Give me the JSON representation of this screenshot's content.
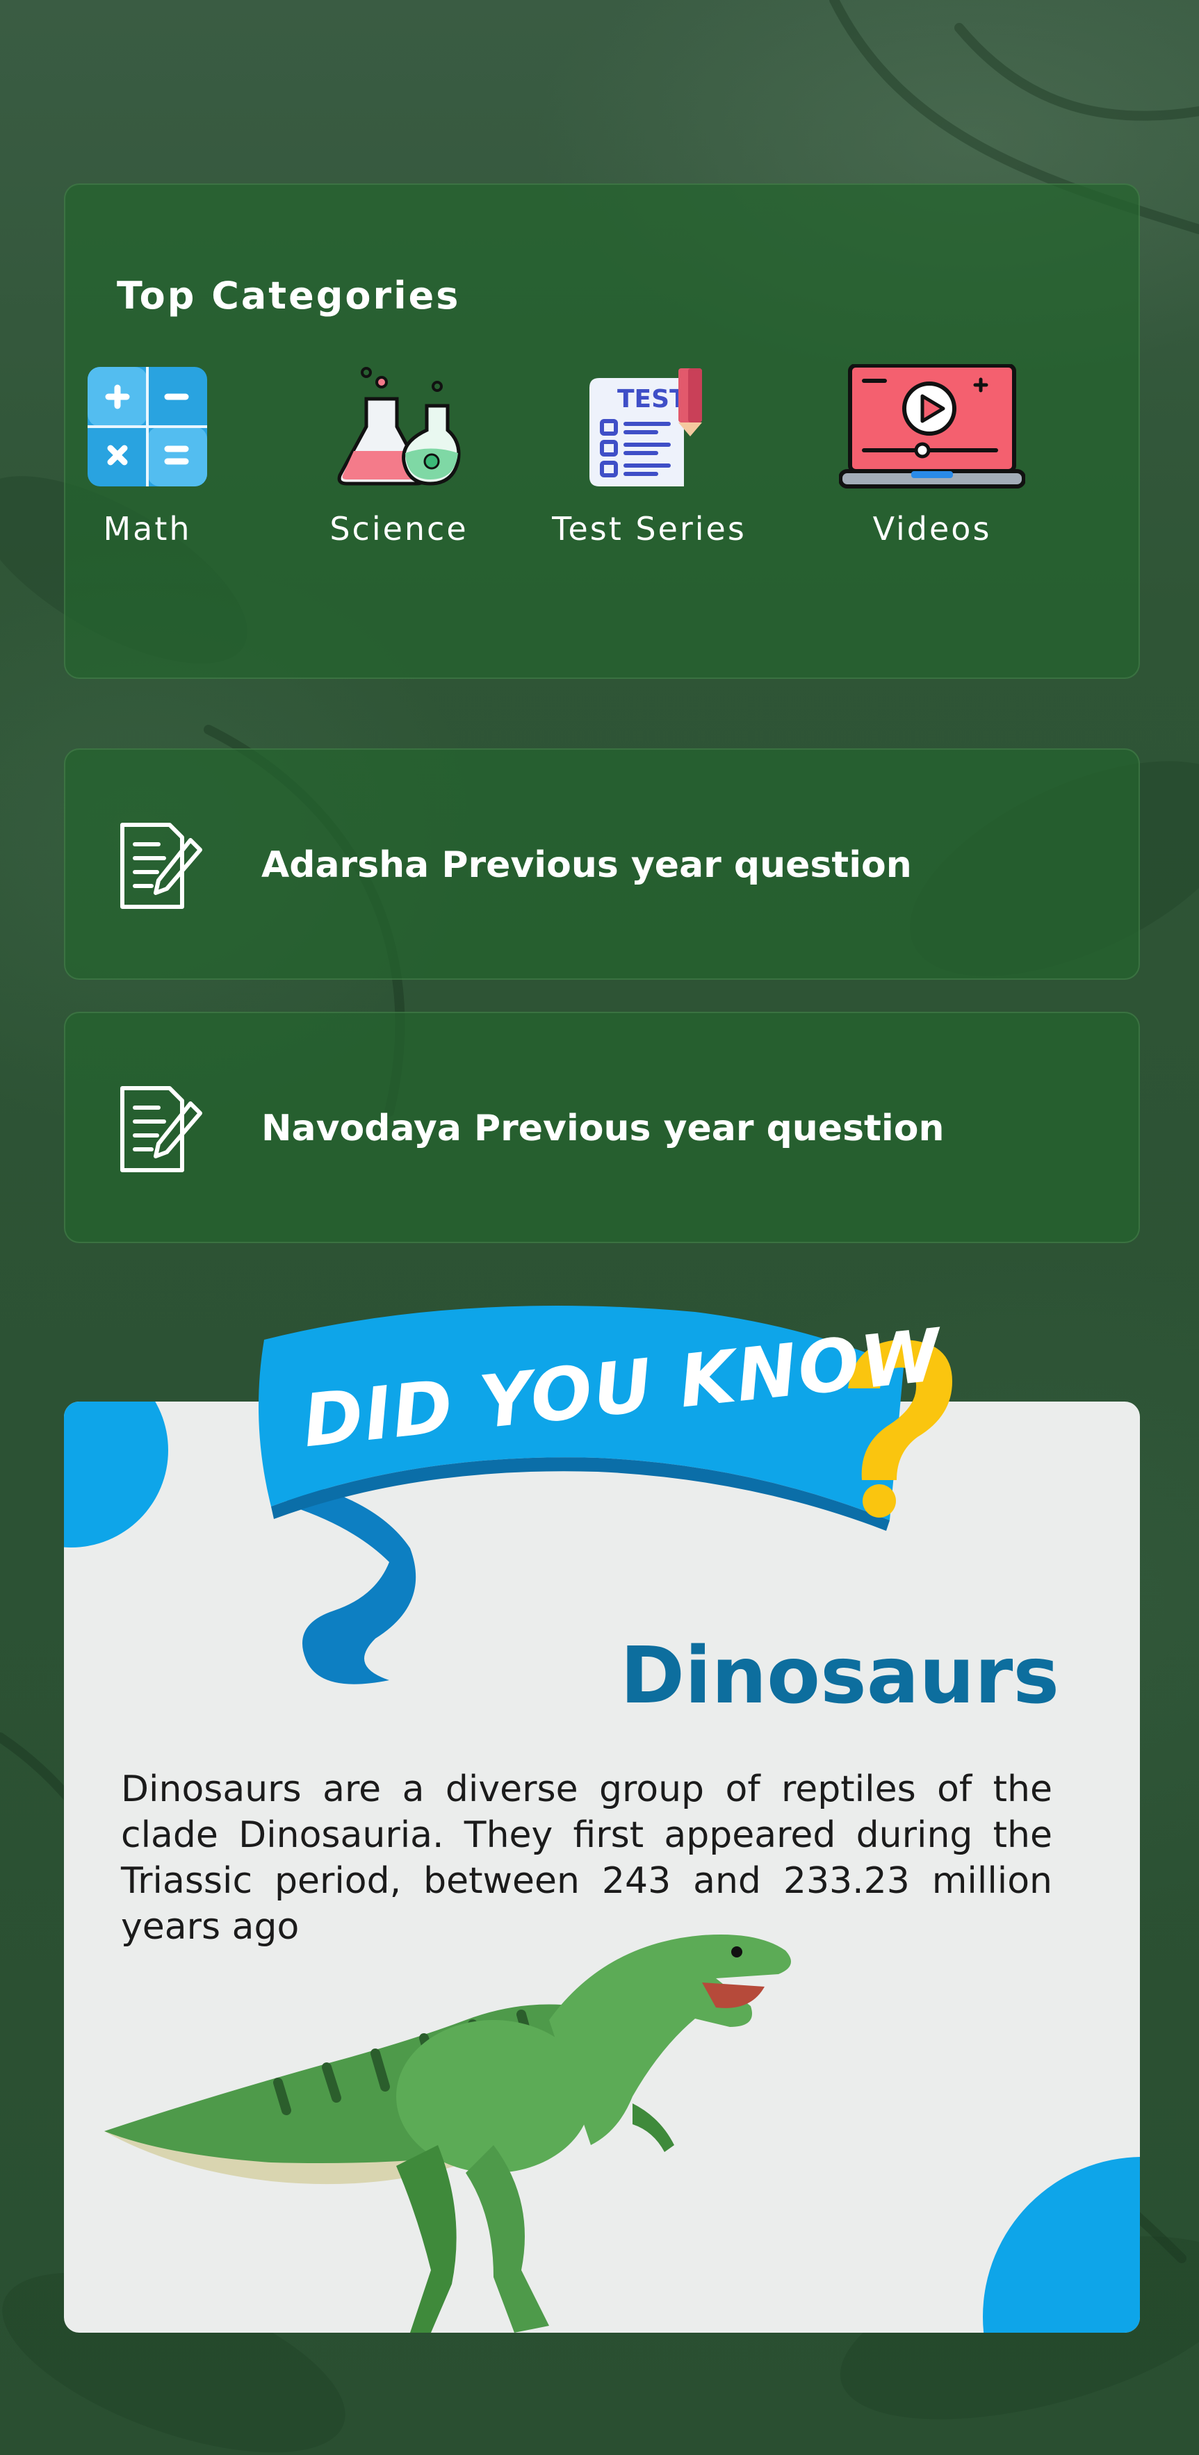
{
  "categories": {
    "title": "Top Categories",
    "items": [
      {
        "label": "Math",
        "icon": "calculator-icon"
      },
      {
        "label": "Science",
        "icon": "flask-icon"
      },
      {
        "label": "Test Series",
        "icon": "test-paper-icon",
        "badge": "TEST"
      },
      {
        "label": "Videos",
        "icon": "laptop-video-icon"
      }
    ]
  },
  "pyq": [
    {
      "label": "Adarsha Previous year question",
      "icon": "document-edit-icon"
    },
    {
      "label": "Navodaya Previous year question",
      "icon": "document-edit-icon"
    }
  ],
  "did_you_know": {
    "banner": "DID YOU KNOW",
    "question_mark": "?",
    "title": "Dinosaurs",
    "text": "Dinosaurs are a diverse group of reptiles of the clade Dinosauria. They first appeared during the Triassic period, between 243 and 233.23 million years ago",
    "image": "t-rex-illustration"
  },
  "colors": {
    "background": "#2b5233",
    "card": "#24642e",
    "accent_blue": "#0ea5e9",
    "title_blue": "#0d6e9e",
    "question_yellow": "#facc15"
  }
}
